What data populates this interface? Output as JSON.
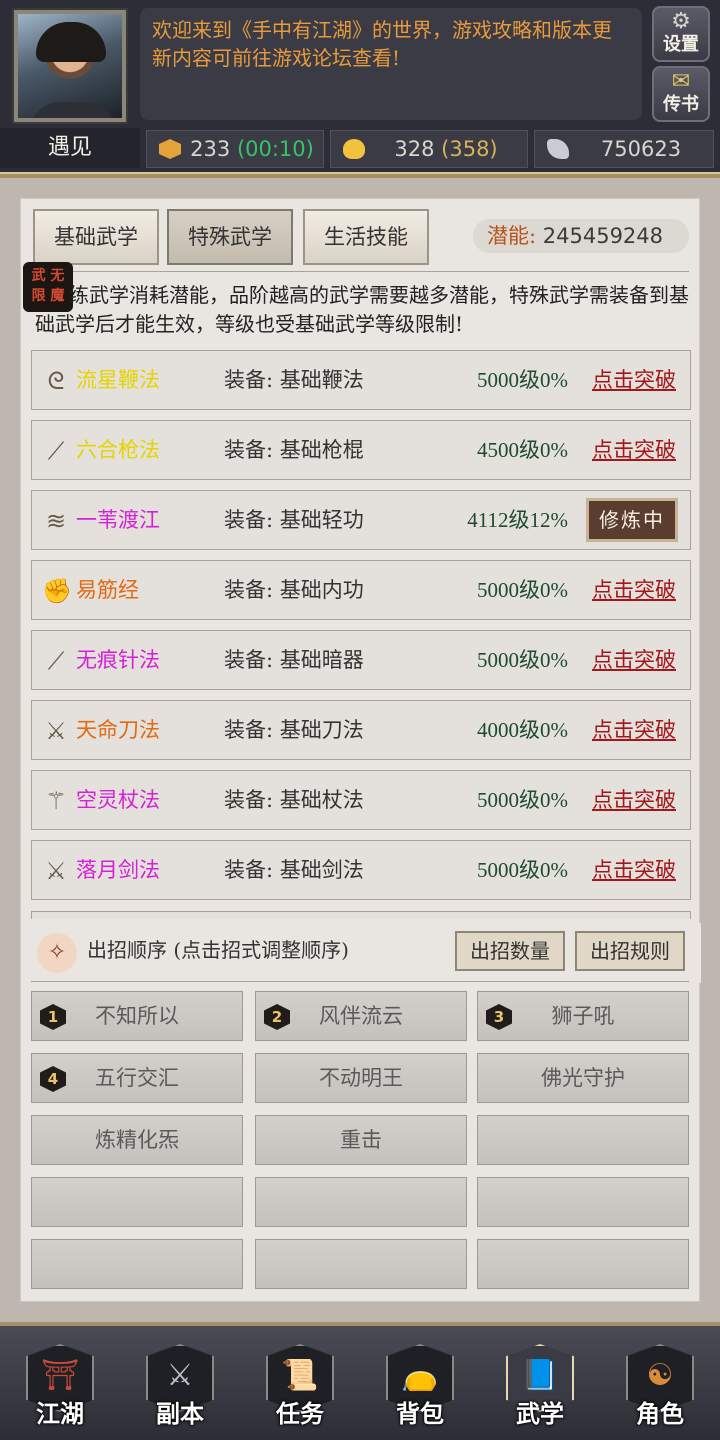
{
  "header": {
    "notice": "欢迎来到《手中有江湖》的世界，游戏攻略和版本更新内容可前往游戏论坛查看!",
    "settings_label": "设置",
    "settings_icon": "gear-icon",
    "mail_label": "传书",
    "mail_icon": "envelope-icon",
    "meet_tab": "遇见"
  },
  "resources": [
    {
      "icon": "gem-icon",
      "value": "233",
      "extra": "(00:10)",
      "extra_color": "#35c46a"
    },
    {
      "icon": "gold-ingot-icon",
      "value": "328",
      "extra": "(358)",
      "extra_color": "#d7b25a"
    },
    {
      "icon": "silver-icon",
      "value": "750623",
      "extra": ""
    }
  ],
  "tabs": [
    "基础武学",
    "特殊武学",
    "生活技能"
  ],
  "active_tab": "特殊武学",
  "potential": {
    "label": "潜能:",
    "value": "245459248"
  },
  "badge_text": "武 无 限 魔",
  "description": "练武学消耗潜能，品阶越高的武学需要越多潜能，特殊武学需装备到基础武学后才能生效，等级也受基础武学等级限制!",
  "skills": [
    {
      "icon": "whip-icon",
      "name": "流星鞭法",
      "color": "#e6d300",
      "equip": "装备: 基础鞭法",
      "level": "5000级0%",
      "action": "点击突破"
    },
    {
      "icon": "spear-icon",
      "name": "六合枪法",
      "color": "#e6d300",
      "equip": "装备: 基础枪棍",
      "level": "4500级0%",
      "action": "点击突破"
    },
    {
      "icon": "boot-icon",
      "name": "一苇渡江",
      "color": "#d620d6",
      "equip": "装备: 基础轻功",
      "level": "4112级12%",
      "action": "修炼中"
    },
    {
      "icon": "muscle-icon",
      "name": "易筋经",
      "color": "#e36a14",
      "equip": "装备: 基础内功",
      "level": "5000级0%",
      "action": "点击突破"
    },
    {
      "icon": "needle-icon",
      "name": "无痕针法",
      "color": "#d620d6",
      "equip": "装备: 基础暗器",
      "level": "5000级0%",
      "action": "点击突破"
    },
    {
      "icon": "sword-icon",
      "name": "天命刀法",
      "color": "#e36a14",
      "equip": "装备: 基础刀法",
      "level": "4000级0%",
      "action": "点击突破"
    },
    {
      "icon": "staff-icon",
      "name": "空灵杖法",
      "color": "#d620d6",
      "equip": "装备: 基础杖法",
      "level": "5000级0%",
      "action": "点击突破"
    },
    {
      "icon": "sword-icon",
      "name": "落月剑法",
      "color": "#d620d6",
      "equip": "装备: 基础剑法",
      "level": "5000级0%",
      "action": "点击突破"
    }
  ],
  "order": {
    "title": "出招顺序 (点击招式调整顺序)",
    "count_button": "出招数量",
    "rules_button": "出招规则"
  },
  "slots": [
    {
      "num": "1",
      "name": "不知所以"
    },
    {
      "num": "2",
      "name": "风伴流云"
    },
    {
      "num": "3",
      "name": "狮子吼"
    },
    {
      "num": "4",
      "name": "五行交汇"
    },
    {
      "num": "",
      "name": "不动明王"
    },
    {
      "num": "",
      "name": "佛光守护"
    },
    {
      "num": "",
      "name": "炼精化炁"
    },
    {
      "num": "",
      "name": "重击"
    },
    {
      "num": "",
      "name": ""
    },
    {
      "num": "",
      "name": ""
    },
    {
      "num": "",
      "name": ""
    },
    {
      "num": "",
      "name": ""
    },
    {
      "num": "",
      "name": ""
    },
    {
      "num": "",
      "name": ""
    },
    {
      "num": "",
      "name": ""
    }
  ],
  "nav": [
    {
      "icon": "palace-icon",
      "label": "江湖"
    },
    {
      "icon": "crossed-swords-icon",
      "label": "副本"
    },
    {
      "icon": "scroll-icon",
      "label": "任务"
    },
    {
      "icon": "bag-icon",
      "label": "背包"
    },
    {
      "icon": "book-icon",
      "label": "武学"
    },
    {
      "icon": "gourd-icon",
      "label": "角色"
    }
  ]
}
